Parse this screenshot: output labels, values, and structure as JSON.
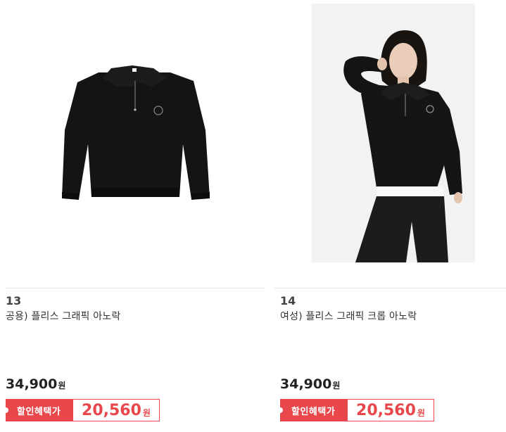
{
  "products": [
    {
      "rank": "13",
      "name": "공용) 플리스 그래픽 아노락",
      "price": "34,900",
      "price_unit": "원",
      "sale_label": "할인혜택가",
      "sale_price": "20,560",
      "sale_unit": "원",
      "image": "black-half-zip-sweater-product-photo"
    },
    {
      "rank": "14",
      "name": "여성) 플리스 그래픽 크롭 아노락",
      "price": "34,900",
      "price_unit": "원",
      "sale_label": "할인혜택가",
      "sale_price": "20,560",
      "sale_unit": "원",
      "image": "model-wearing-black-half-zip-photo"
    }
  ],
  "colors": {
    "accent": "#e8484c",
    "sweater": "#111111"
  }
}
